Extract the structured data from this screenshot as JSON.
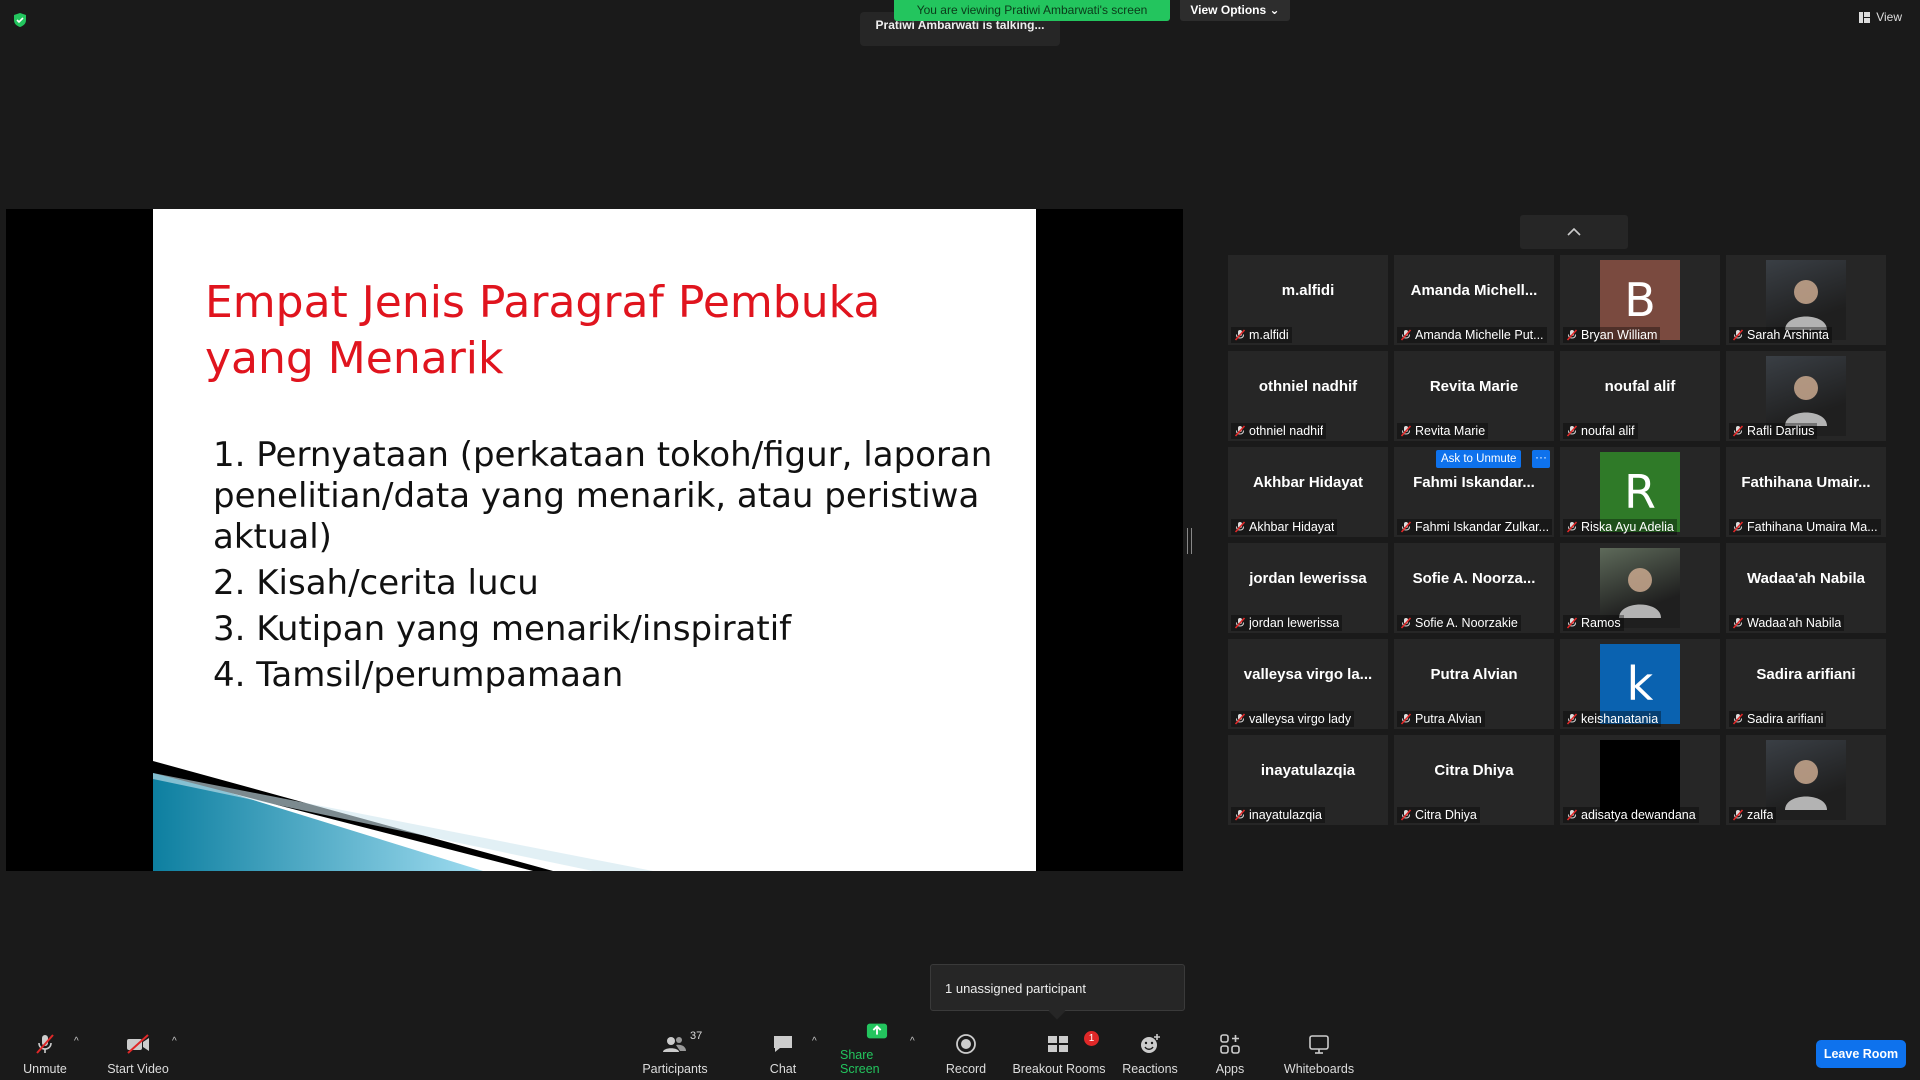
{
  "top": {
    "viewing_banner": "You are viewing Pratiwi Ambarwati's screen",
    "view_options": "View Options",
    "talking": "Pratiwi Ambarwati is talking...",
    "view_label": "View"
  },
  "slide": {
    "title": "Empat Jenis Paragraf Pembuka yang Menarik",
    "items": [
      "1. Pernyataan (perkataan tokoh/figur, laporan penelitian/data yang menarik, atau peristiwa aktual)",
      "2. Kisah/cerita lucu",
      "3. Kutipan yang menarik/inspiratif",
      "4. Tamsil/perumpamaan"
    ]
  },
  "tiles": [
    {
      "display": "m.alfidi",
      "name": "m.alfidi"
    },
    {
      "display": "Amanda  Michell...",
      "name": "Amanda Michelle Put..."
    },
    {
      "avatar_letter": "B",
      "avatar_color": "#7a4a3f",
      "name": "Bryan William"
    },
    {
      "photo": true,
      "name": "Sarah Arshinta"
    },
    {
      "display": "othniel nadhif",
      "name": "othniel nadhif"
    },
    {
      "display": "Revita Marie",
      "name": "Revita Marie"
    },
    {
      "display": "noufal alif",
      "name": "noufal alif"
    },
    {
      "photo": true,
      "name": "Rafli Darlius"
    },
    {
      "display": "Akhbar Hidayat",
      "name": "Akhbar Hidayat"
    },
    {
      "display": "Fahmi  Iskandar...",
      "name": "Fahmi Iskandar Zulkar...",
      "ask": "Ask to Unmute",
      "more": "···"
    },
    {
      "avatar_letter": "R",
      "avatar_color": "#2f7a28",
      "name": "Riska Ayu Adelia"
    },
    {
      "display": "Fathihana  Umair...",
      "name": "Fathihana Umaira Ma..."
    },
    {
      "display": "jordan lewerissa",
      "name": "jordan lewerissa"
    },
    {
      "display": "Sofie  A.  Noorza...",
      "name": "Sofie A. Noorzakie"
    },
    {
      "photo": true,
      "name": "Ramos"
    },
    {
      "display": "Wadaa'ah Nabila",
      "name": "Wadaa'ah Nabila"
    },
    {
      "display": "valleysa  virgo  la...",
      "name": "valleysa virgo lady"
    },
    {
      "display": "Putra Alvian",
      "name": "Putra Alvian"
    },
    {
      "avatar_letter": "k",
      "avatar_color": "#0a62b0",
      "name": "keishanatania"
    },
    {
      "display": "Sadira arifiani",
      "name": "Sadira arifiani"
    },
    {
      "display": "inayatulazqia",
      "name": "inayatulazqia"
    },
    {
      "display": "Citra Dhiya",
      "name": "Citra Dhiya"
    },
    {
      "avatar_color": "#000000",
      "name": "adisatya dewandana"
    },
    {
      "photo": true,
      "name": "zalfa"
    }
  ],
  "tooltip": "1 unassigned participant",
  "toolbar": {
    "unmute": "Unmute",
    "start_video": "Start Video",
    "participants": "Participants",
    "participants_count": "37",
    "chat": "Chat",
    "share_screen": "Share Screen",
    "record": "Record",
    "breakout_rooms": "Breakout Rooms",
    "breakout_badge": "1",
    "reactions": "Reactions",
    "apps": "Apps",
    "whiteboards": "Whiteboards",
    "leave_room": "Leave Room"
  }
}
